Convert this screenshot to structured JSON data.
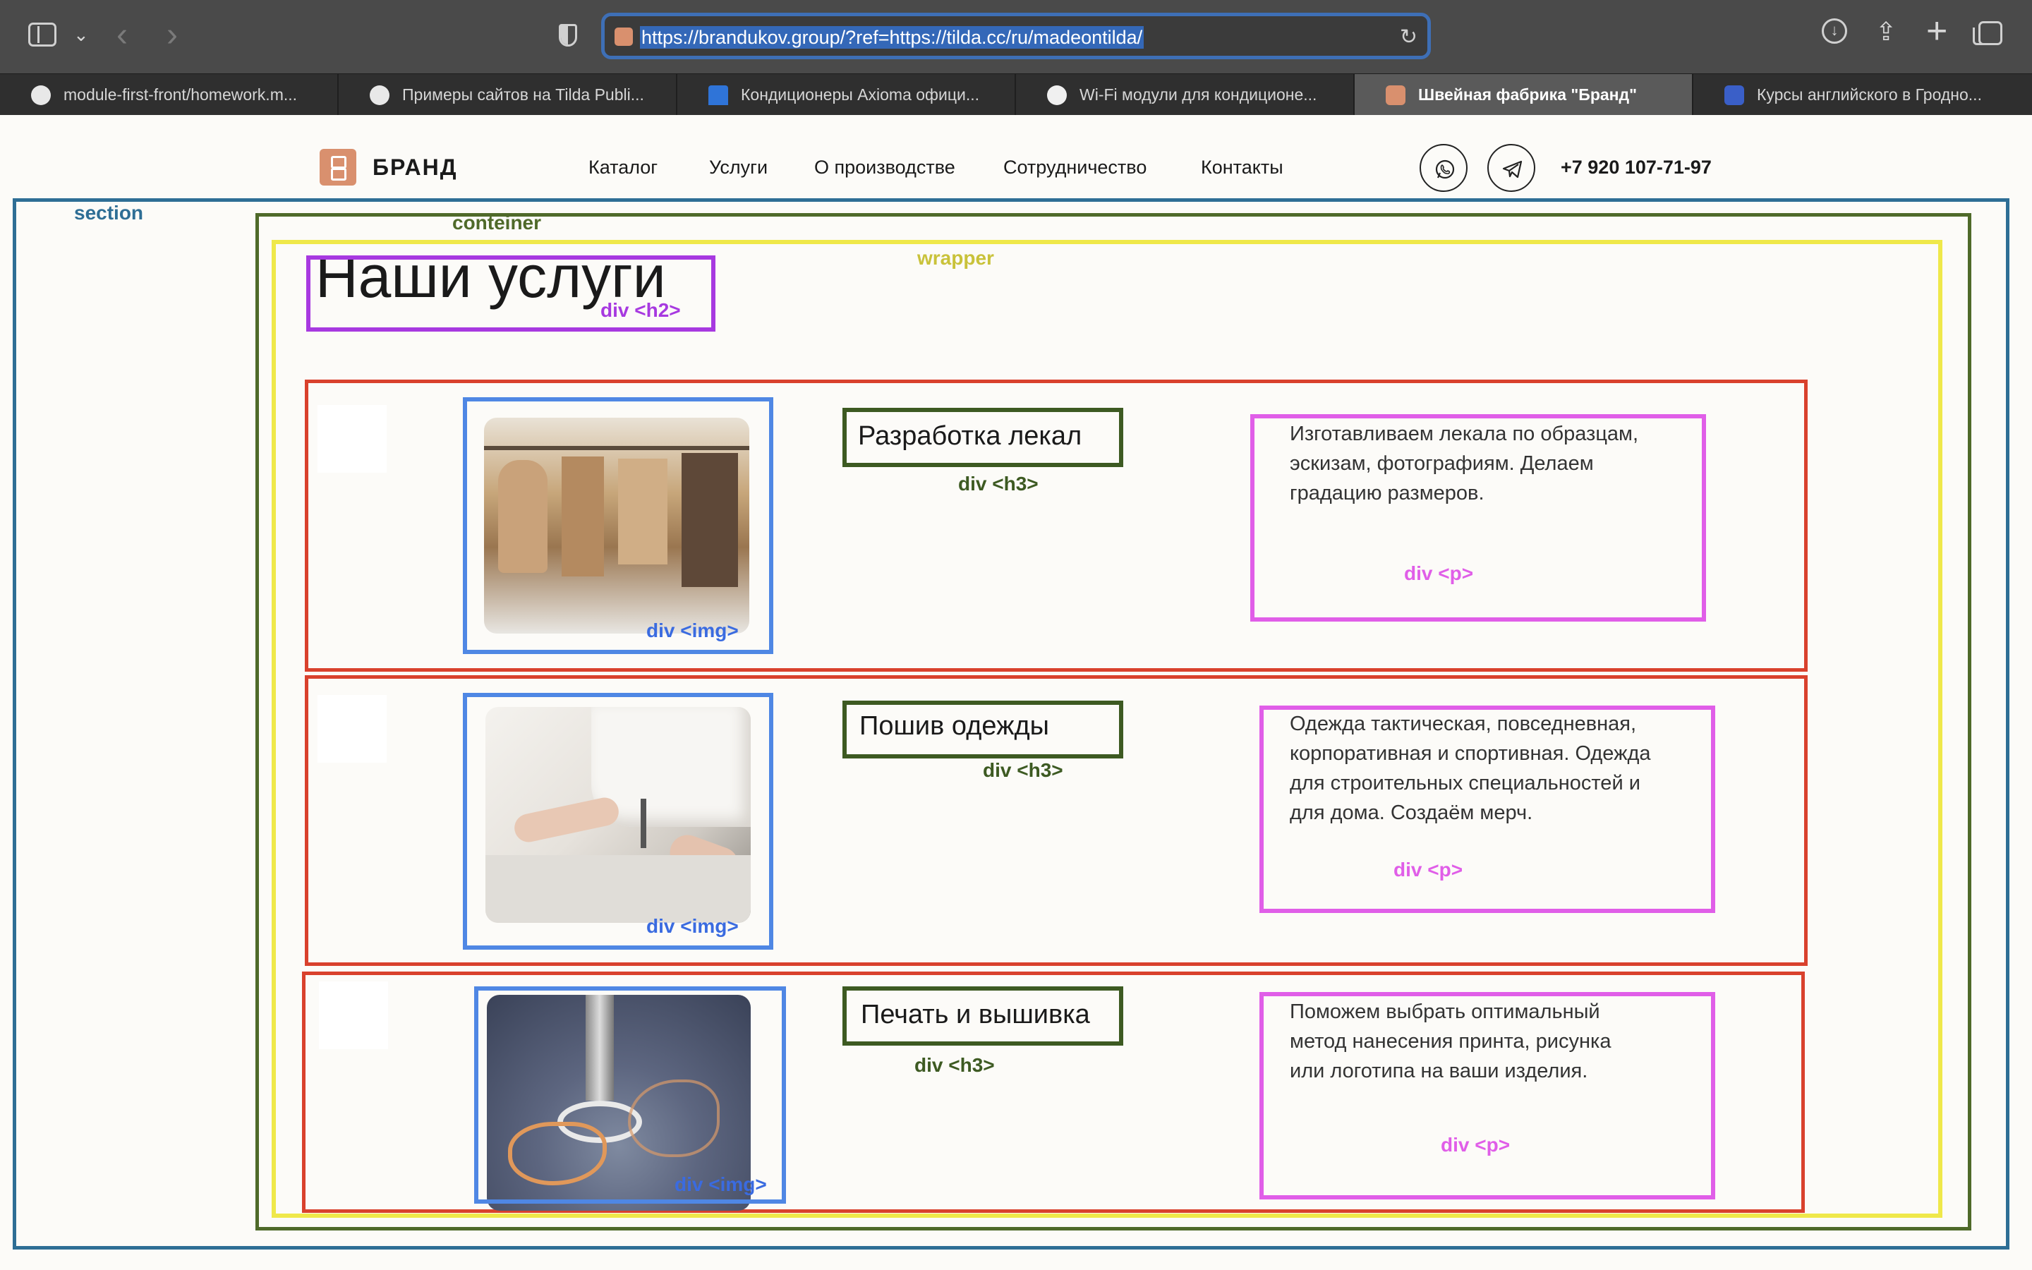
{
  "browser": {
    "url": "https://brandukov.group/?ref=https://tilda.cc/ru/madeontilda/",
    "tabs": [
      {
        "label": "module-first-front/homework.m...",
        "active": false
      },
      {
        "label": "Примеры сайтов на Tilda Publi...",
        "active": false
      },
      {
        "label": "Кондиционеры Axioma офици...",
        "active": false
      },
      {
        "label": "Wi-Fi модули для кондиционе...",
        "active": false
      },
      {
        "label": "Швейная фабрика \"Бранд\"",
        "active": true
      },
      {
        "label": "Курсы английского в Гродно...",
        "active": false
      }
    ]
  },
  "site": {
    "logo_text": "БРАНД",
    "nav": [
      "Каталог",
      "Услуги",
      "О производстве",
      "Сотрудничество",
      "Контакты"
    ],
    "phone": "+7 920 107-71-97"
  },
  "annotations": {
    "section": "section",
    "container": "conteiner",
    "wrapper": "wrapper",
    "h2": "div <h2>",
    "img": "div <img>",
    "h3": "div <h3>",
    "p": "div <p>"
  },
  "heading": "Наши услуги",
  "services": [
    {
      "title": "Разработка лекал",
      "text_lines": [
        "Изготавливаем лекала по образцам,",
        "эскизам, фотографиям. Делаем",
        "градацию размеров."
      ]
    },
    {
      "title": "Пошив одежды",
      "text_lines": [
        "Одежда тактическая, повседневная,",
        "корпоративная и спортивная. Одежда",
        "для строительных специальностей и",
        "для дома. Создаём мерч."
      ]
    },
    {
      "title": "Печать и вышивка",
      "text_lines": [
        "Поможем выбрать оптимальный",
        "метод нанесения принта, рисунка",
        "или логотипа на ваши изделия."
      ]
    }
  ],
  "colors": {
    "section": "#2e6e95",
    "container": "#4f6a2a",
    "wrapper": "#efe84a",
    "h2": "#a739e0",
    "row": "#d9412d",
    "img": "#4f87e4",
    "h3": "#3d5a22",
    "p": "#e05ee8",
    "logo": "#d9906e"
  }
}
